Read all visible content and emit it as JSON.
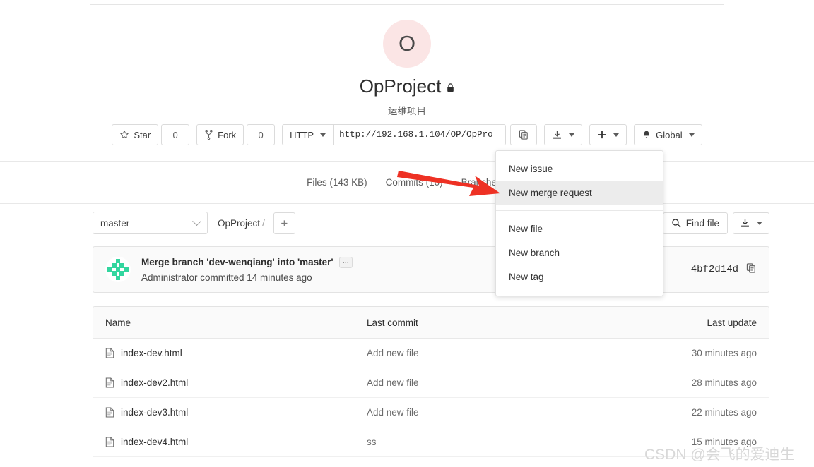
{
  "project": {
    "avatar_letter": "O",
    "name": "OpProject",
    "visibility_icon": "lock-icon",
    "description": "运维项目"
  },
  "actions": {
    "star_label": "Star",
    "star_count": "0",
    "fork_label": "Fork",
    "fork_count": "0",
    "protocol_label": "HTTP",
    "clone_url": "http://192.168.1.104/OP/OpPro",
    "copy_icon": "copy-icon",
    "download_icon": "download-icon",
    "plus_icon": "plus-icon",
    "notification_icon": "bell-icon",
    "notification_label": "Global"
  },
  "stats": [
    {
      "label": "Files (143 KB)"
    },
    {
      "label": "Commits (10)"
    },
    {
      "label": "Branches ("
    }
  ],
  "dropdown": {
    "items": [
      {
        "label": "New issue",
        "active": false
      },
      {
        "label": "New merge request",
        "active": true
      },
      {
        "label": "New file",
        "active": false
      },
      {
        "label": "New branch",
        "active": false
      },
      {
        "label": "New tag",
        "active": false
      }
    ]
  },
  "repo_toolbar": {
    "branch": "master",
    "breadcrumb_project": "OpProject",
    "breadcrumb_sep": "/",
    "add_label": "+",
    "find_file_label": "Find file",
    "search_icon": "search-icon",
    "download_icon": "download-icon"
  },
  "last_commit": {
    "message": "Merge branch 'dev-wenqiang' into 'master'",
    "ellipsis_label": "...",
    "meta": "Administrator committed 14 minutes ago",
    "sha": "4bf2d14d",
    "copy_icon": "copy-icon",
    "avatar": "identicon"
  },
  "file_table": {
    "headers": {
      "name": "Name",
      "last_commit": "Last commit",
      "last_update": "Last update"
    },
    "rows": [
      {
        "name": "index-dev.html",
        "icon": "file-icon",
        "commit": "Add new file",
        "update": "30 minutes ago"
      },
      {
        "name": "index-dev2.html",
        "icon": "file-icon",
        "commit": "Add new file",
        "update": "28 minutes ago"
      },
      {
        "name": "index-dev3.html",
        "icon": "file-icon",
        "commit": "Add new file",
        "update": "22 minutes ago"
      },
      {
        "name": "index-dev4.html",
        "icon": "file-icon",
        "commit": "ss",
        "update": "15 minutes ago"
      }
    ]
  },
  "annotation": {
    "arrow_color": "#ee3124"
  },
  "watermark": {
    "text": "CSDN @会飞的爱迪生"
  },
  "colors": {
    "avatar_bg": "#fbe5e5",
    "border": "#dbdbdb",
    "panel_bg": "#fafafa",
    "text": "#2e2e2e",
    "muted": "#6b6b6b",
    "identicon": "#33d69f"
  }
}
